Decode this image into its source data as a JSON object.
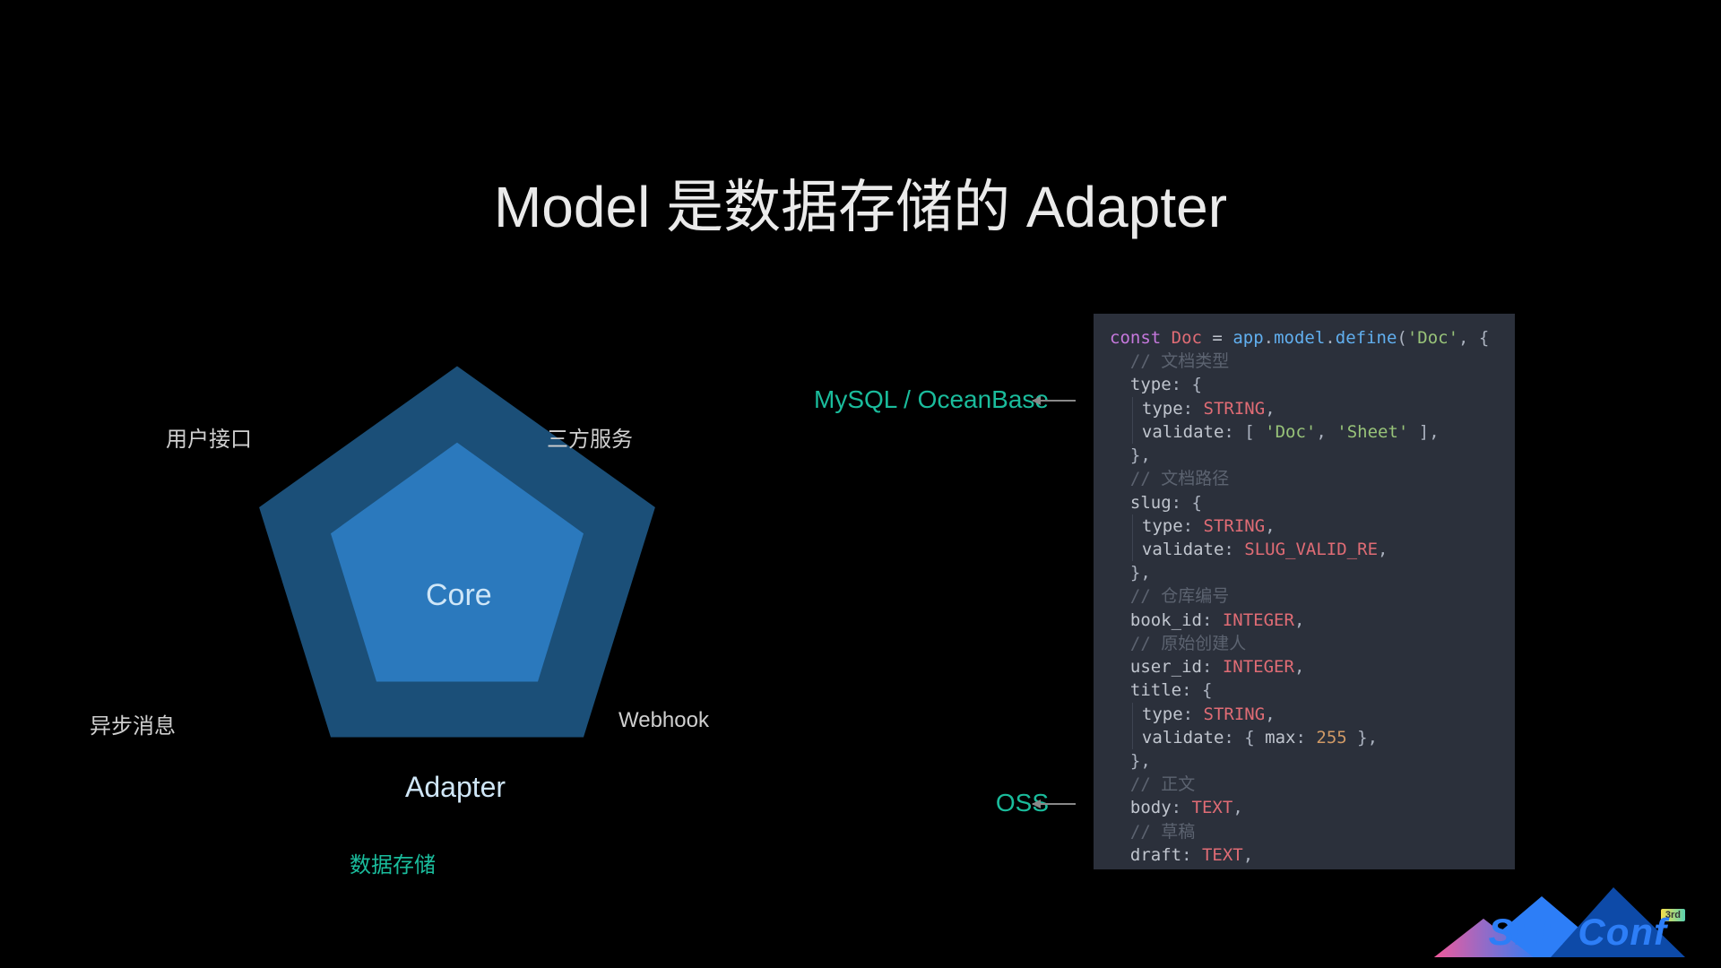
{
  "title": "Model 是数据存储的 Adapter",
  "pentagon": {
    "core": "Core",
    "adapter": "Adapter",
    "labels": {
      "top_left": "用户接口",
      "top_right": "三方服务",
      "bottom_left": "异步消息",
      "bottom_right": "Webhook",
      "bottom": "数据存储"
    }
  },
  "pointers": {
    "top": "MySQL / OceanBase",
    "bottom": "OSS"
  },
  "code": {
    "l1_const": "const",
    "l1_Doc": "Doc",
    "l1_eq": " = ",
    "l1_app": "app",
    "l1_model": "model",
    "l1_define": "define",
    "l1_docstr": "'Doc'",
    "c_type": "// 文档类型",
    "k_type": "type",
    "v_STRING": "STRING",
    "k_validate": "validate",
    "arr_doc": "'Doc'",
    "arr_sheet": "'Sheet'",
    "c_slug": "// 文档路径",
    "k_slug": "slug",
    "v_SLUG": "SLUG_VALID_RE",
    "c_book": "// 仓库编号",
    "k_book": "book_id",
    "v_INTEGER": "INTEGER",
    "c_user": "// 原始创建人",
    "k_user": "user_id",
    "k_title": "title",
    "k_max": "max",
    "v_255": "255",
    "c_body": "// 正文",
    "k_body": "body",
    "v_TEXT": "TEXT",
    "c_draft": "// 草稿",
    "k_draft": "draft"
  },
  "logo": {
    "text": "SEE Conf",
    "badge": "3rd"
  }
}
